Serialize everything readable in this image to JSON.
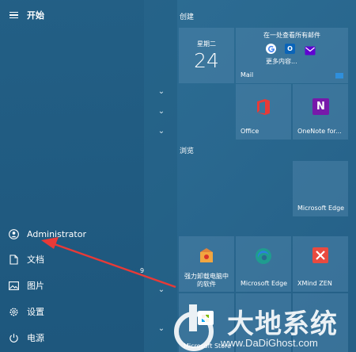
{
  "start_menu": {
    "title": "开始",
    "user": "Administrator",
    "items": [
      {
        "label": "文档"
      },
      {
        "label": "图片"
      },
      {
        "label": "设置"
      },
      {
        "label": "电源"
      }
    ],
    "count_badge": "9"
  },
  "groups": {
    "create": "创建",
    "browse": "浏览"
  },
  "tiles": {
    "calendar": {
      "day_name": "星期二",
      "day_number": "24"
    },
    "mail": {
      "heading": "在一处查看所有邮件",
      "more": "更多内容...",
      "label": "Mail"
    },
    "office": {
      "label": "Office"
    },
    "onenote": {
      "label": "OneNote for..."
    },
    "edge_browse": {
      "label": "Microsoft Edge"
    },
    "uninstaller": {
      "label": "强力卸载电脑中的软件"
    },
    "edge2": {
      "label": "Microsoft Edge"
    },
    "xmind": {
      "label": "XMind ZEN"
    },
    "store": {
      "label": "Microsoft Store"
    }
  },
  "watermark": {
    "brand": "大地系统",
    "url": "www.DaDiGhost.com"
  },
  "colors": {
    "accent_red": "#e83a37",
    "office_red": "#d83b01",
    "onenote_purple": "#7719aa",
    "edge_teal": "#1f9c8f",
    "xmind_red": "#e94a3f"
  }
}
